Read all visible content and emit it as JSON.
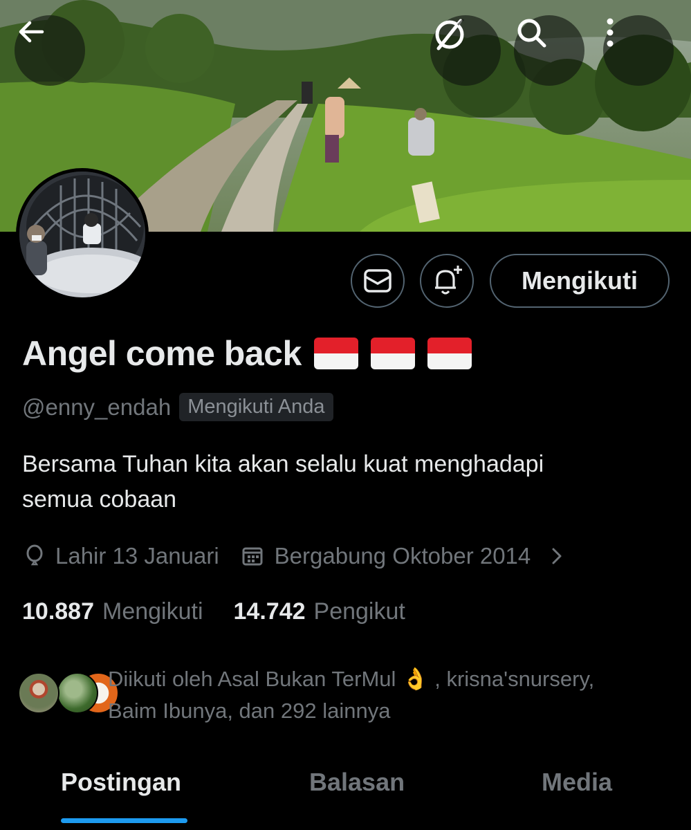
{
  "header": {
    "back_icon": "arrow-left-icon",
    "grok_icon": "grok-icon",
    "search_icon": "search-icon",
    "more_icon": "more-vertical-icon"
  },
  "actions": {
    "message_icon": "mail-icon",
    "notify_icon": "bell-plus-icon",
    "follow_label": "Mengikuti"
  },
  "profile": {
    "display_name": "Angel come back",
    "flags": [
      "indonesia-flag",
      "indonesia-flag",
      "indonesia-flag"
    ],
    "handle": "@enny_endah",
    "follows_you_badge": "Mengikuti Anda",
    "bio_line1": "Bersama Tuhan kita akan selalu kuat menghadapi",
    "bio_line2": "semua cobaan",
    "birthday": "Lahir 13 Januari",
    "joined": "Bergabung Oktober 2014"
  },
  "stats": {
    "following_count": "10.887",
    "following_label": "Mengikuti",
    "followers_count": "14.742",
    "followers_label": "Pengikut"
  },
  "followed_by": {
    "line1": "Diikuti oleh Asal Bukan TerMul 👌 , krisna'snursery,",
    "line2": "Baim Ibunya, dan 292 lainnya"
  },
  "tabs": [
    {
      "label": "Postingan",
      "active": true
    },
    {
      "label": "Balasan",
      "active": false
    },
    {
      "label": "Media",
      "active": false
    }
  ],
  "colors": {
    "accent": "#1d9bf0",
    "background": "#000000",
    "secondary_text": "#71767b",
    "border": "#536471"
  }
}
